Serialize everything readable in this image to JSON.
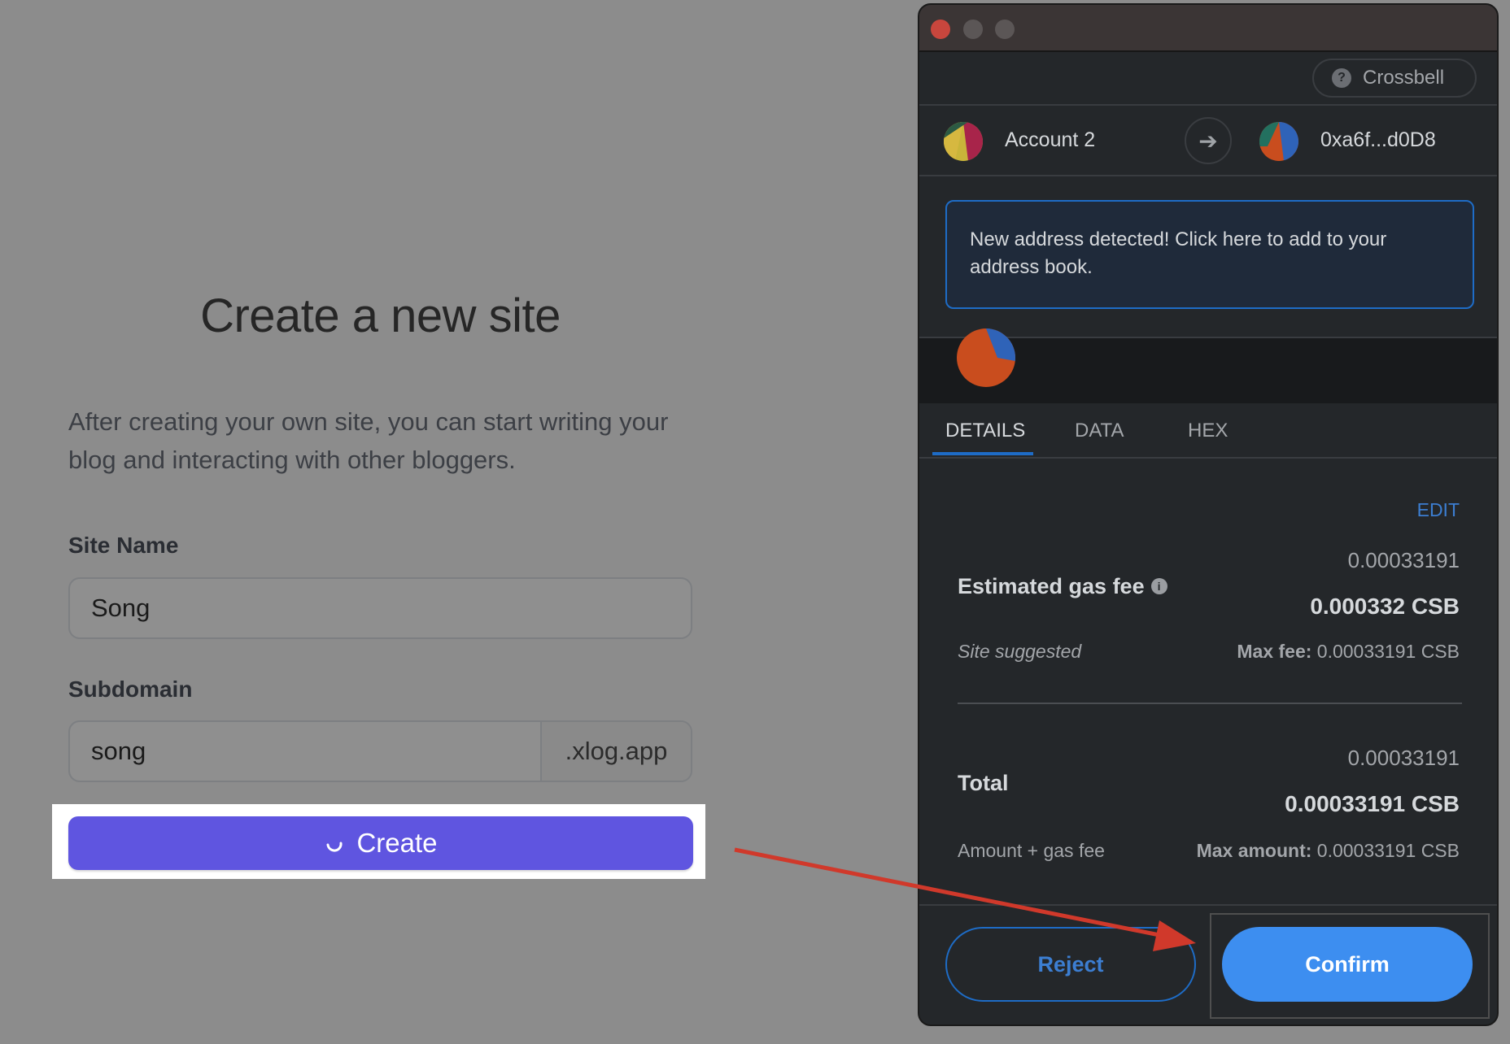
{
  "page": {
    "title": "Create a new site",
    "description": "After creating your own site, you can start writing your blog and interacting with other bloggers.",
    "site_name_label": "Site Name",
    "site_name_value": "Song",
    "subdomain_label": "Subdomain",
    "subdomain_value": "song",
    "subdomain_suffix": ".xlog.app",
    "create_label": "Create"
  },
  "wallet": {
    "network": "Crossbell",
    "from_account": "Account 2",
    "to_address": "0xa6f...d0D8",
    "notice": "New address detected! Click here to add to your address book.",
    "tabs": [
      "DETAILS",
      "DATA",
      "HEX"
    ],
    "active_tab": "DETAILS",
    "edit_label": "EDIT",
    "gas": {
      "label": "Estimated gas fee",
      "value_small": "0.00033191",
      "value_bold": "0.000332 CSB",
      "suggested": "Site suggested",
      "max_fee_label": "Max fee:",
      "max_fee_value": "0.00033191 CSB"
    },
    "total": {
      "label": "Total",
      "value_small": "0.00033191",
      "value_bold": "0.00033191 CSB",
      "sub_label": "Amount + gas fee",
      "max_amount_label": "Max amount:",
      "max_amount_value": "0.00033191 CSB"
    },
    "reject_label": "Reject",
    "confirm_label": "Confirm"
  },
  "colors": {
    "backdrop": "#8c8c8c",
    "create_button": "#5f55e0",
    "wallet_bg": "#24272a",
    "accent_blue": "#3d8ef0",
    "annotation_arrow": "#d0392b"
  }
}
